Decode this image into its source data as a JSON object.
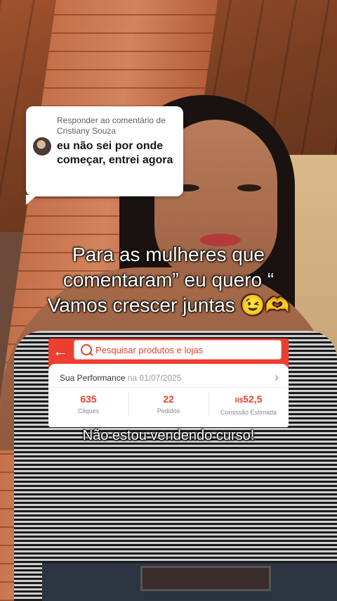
{
  "reply": {
    "header": "Responder ao comentário de Cristiany Souza",
    "comment": "eu não sei por onde começar, entrei agora"
  },
  "caption": {
    "line1": "Para as mulheres que",
    "line2": "comentaram” eu quero “",
    "line3": "Vamos crescer juntas 😉🫶"
  },
  "app": {
    "search_placeholder": "Pesquisar produtos e lojas",
    "performance_title": "Sua Performance",
    "performance_date": "na 01/07/2025",
    "metrics": [
      {
        "value": "635",
        "label": "Cliques"
      },
      {
        "value": "22",
        "label": "Pedidos"
      },
      {
        "currency": "R$",
        "value": "52,5",
        "label": "Comissão Estimada"
      }
    ],
    "accent_color": "#ee3e2f"
  },
  "subcaption": "Não estou vendendo curso!"
}
